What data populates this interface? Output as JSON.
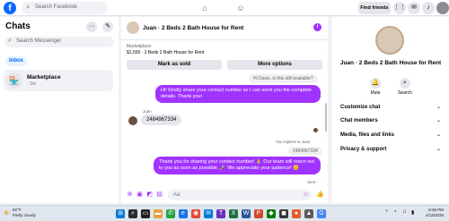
{
  "topbar": {
    "logo": "f",
    "search_placeholder": "Search Facebook",
    "nav_icons": [
      "home-icon",
      "groups-icon"
    ],
    "find_friends": "Find friends"
  },
  "left": {
    "title": "Chats",
    "search_placeholder": "Search Messenger",
    "filter": "Inbox",
    "conversations": [
      {
        "name": "Marketplace",
        "time": "· 1m",
        "icon": "store-icon"
      }
    ]
  },
  "chat": {
    "name": "Juan · 2 Beds 2 Bath House for Rent",
    "listing_label": "Marketplace",
    "listing_detail": "$1,500 · 2 Beds 2 Bath House for Rent",
    "mark_sold": "Mark as sold",
    "more_options": "More options",
    "messages": [
      {
        "type": "in-auto",
        "text": "Hi Davis, is this still available?"
      },
      {
        "type": "out",
        "text": "Hi! Kindly share your contact number so I can send you the complete details. Thank you!"
      },
      {
        "type": "sender",
        "text": "Juan"
      },
      {
        "type": "in",
        "text": "2484967334"
      },
      {
        "type": "reply-meta",
        "text": "You replied to Juan"
      },
      {
        "type": "in-quote",
        "text": "2484967334"
      },
      {
        "type": "out",
        "text": "Thank you for sharing your contact number! 🙏 Our team will reach out to you as soon as possible. 🚀 We appreciate your patience! 😊"
      },
      {
        "type": "status",
        "text": "Sent"
      }
    ],
    "composer_placeholder": "Aa"
  },
  "right": {
    "name": "Juan · 2 Beds 2 Bath House for Rent",
    "actions": [
      {
        "label": "Mute",
        "icon": "bell-icon"
      },
      {
        "label": "Search",
        "icon": "search-icon"
      }
    ],
    "sections": [
      "Customize chat",
      "Chat members",
      "Media, files and links",
      "Privacy & support"
    ]
  },
  "taskbar": {
    "temperature": "82°F",
    "condition": "Partly cloudy",
    "time": "8:26 PM",
    "date": "4/13/2025"
  },
  "colors": {
    "accent": "#a033ff",
    "facebook_blue": "#0866ff"
  }
}
